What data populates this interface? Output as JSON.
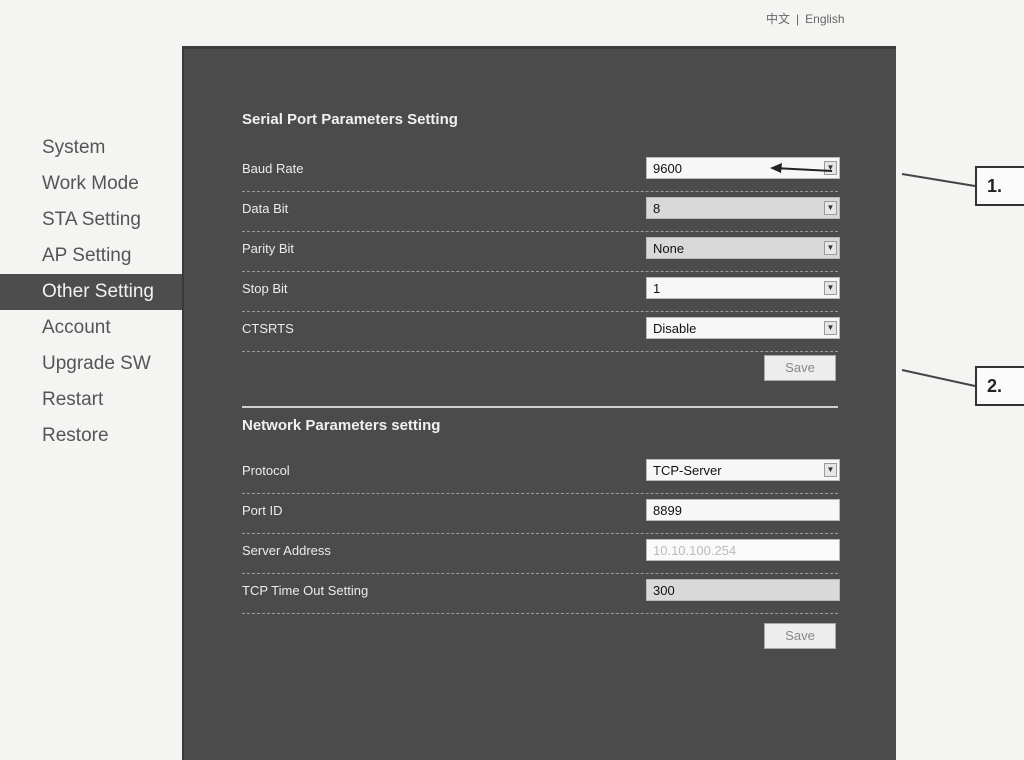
{
  "language": {
    "chinese": "中文",
    "separator": "|",
    "english": "English"
  },
  "sidebar": {
    "items": [
      {
        "label": "System",
        "active": false
      },
      {
        "label": "Work Mode",
        "active": false
      },
      {
        "label": "STA Setting",
        "active": false
      },
      {
        "label": "AP Setting",
        "active": false
      },
      {
        "label": "Other Setting",
        "active": true
      },
      {
        "label": "Account",
        "active": false
      },
      {
        "label": "Upgrade SW",
        "active": false
      },
      {
        "label": "Restart",
        "active": false
      },
      {
        "label": "Restore",
        "active": false
      }
    ]
  },
  "serial": {
    "title": "Serial Port Parameters Setting",
    "baud_rate": {
      "label": "Baud Rate",
      "value": "9600"
    },
    "data_bit": {
      "label": "Data Bit",
      "value": "8"
    },
    "parity_bit": {
      "label": "Parity Bit",
      "value": "None"
    },
    "stop_bit": {
      "label": "Stop Bit",
      "value": "1"
    },
    "ctsrts": {
      "label": "CTSRTS",
      "value": "Disable"
    },
    "save_label": "Save"
  },
  "network": {
    "title": "Network Parameters setting",
    "protocol": {
      "label": "Protocol",
      "value": "TCP-Server"
    },
    "port_id": {
      "label": "Port ID",
      "value": "8899"
    },
    "server_address": {
      "label": "Server Address",
      "value": "10.10.100.254"
    },
    "tcp_timeout": {
      "label": "TCP Time Out Setting",
      "value": "300"
    },
    "save_label": "Save"
  },
  "callouts": {
    "one": "1.",
    "two": "2."
  }
}
